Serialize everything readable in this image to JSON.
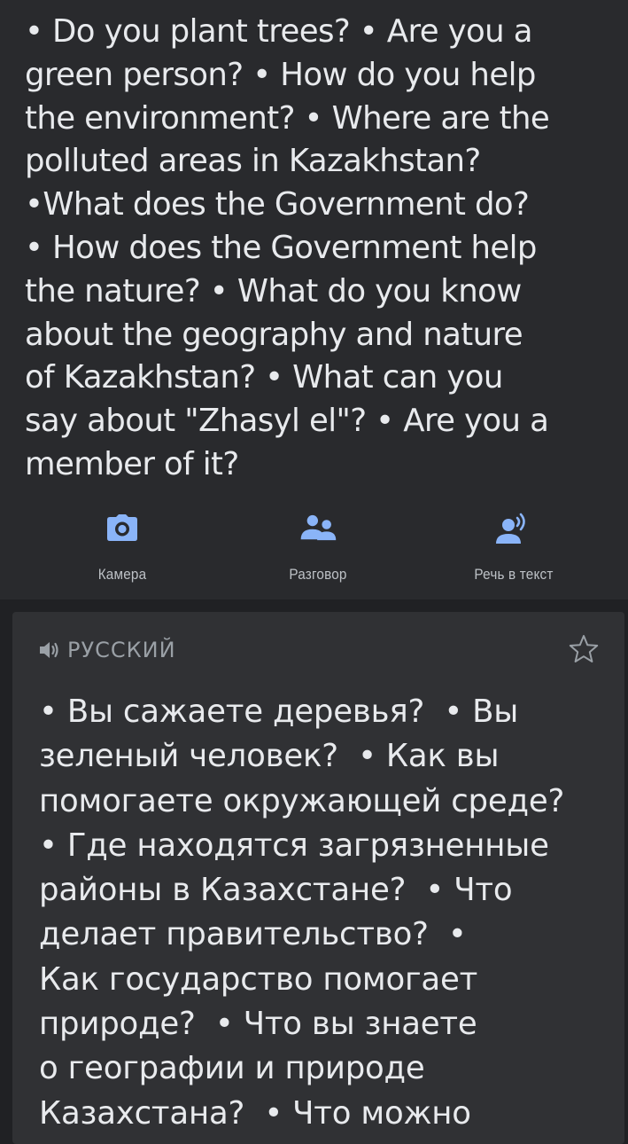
{
  "source": {
    "lines": [
      "• Do you plant trees? • Are you a",
      "green person? • How do you help",
      "the environment? • Where are the",
      "polluted areas in Kazakhstan?",
      "•What does the Government do?",
      "• How does the Government help",
      "the nature? • What do you know",
      "about the geography and nature",
      "of Kazakhstan? • What can you",
      "say about \"Zhasyl el\"? • Are you a",
      "member of it?"
    ]
  },
  "actions": {
    "camera": {
      "label": "Камера",
      "icon": "camera-icon"
    },
    "conversation": {
      "label": "Разговор",
      "icon": "conversation-icon"
    },
    "transcribe": {
      "label": "Речь в текст",
      "icon": "transcribe-icon"
    }
  },
  "translation": {
    "language": "РУССКИЙ",
    "lines": [
      "• Вы сажаете деревья?  • Вы",
      "зеленый человек?  • Как вы",
      "помогаете окружающей среде?",
      "• Где находятся загрязненные",
      "районы в Казахстане?  • Что",
      "делает правительство?  •",
      "Как государство помогает",
      "природе?  • Что вы знаете",
      "о географии и природе",
      "Казахстана?  • Что можно"
    ]
  },
  "colors": {
    "accent": "#8ab4f8",
    "background": "#202124",
    "source_background": "#292a2d",
    "card_background": "#303134",
    "text": "#e8eaed",
    "muted_text": "#9aa0a6"
  }
}
